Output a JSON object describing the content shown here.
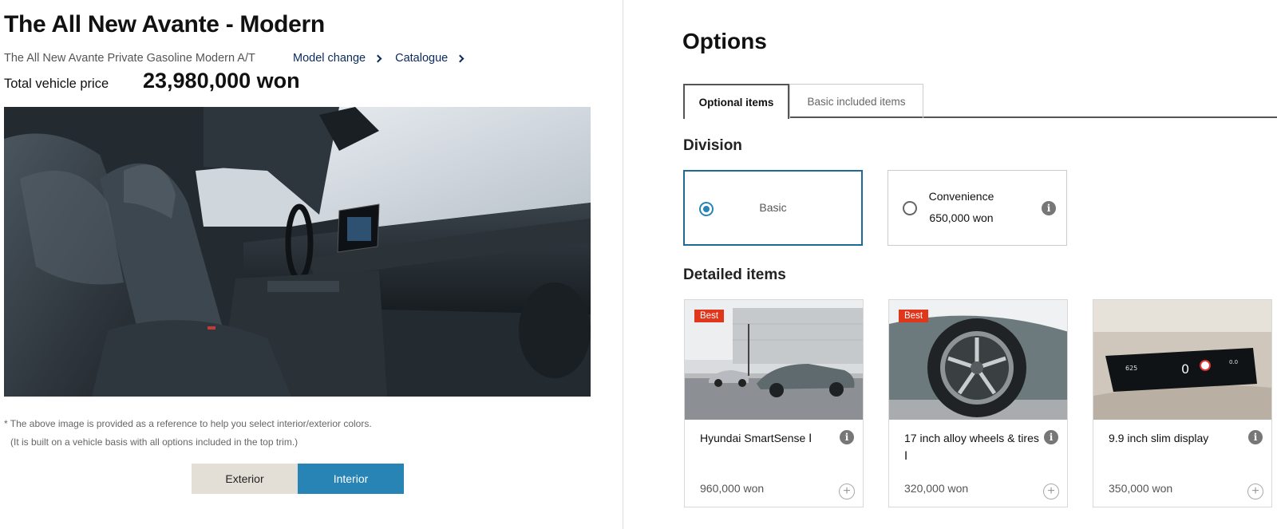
{
  "header": {
    "title": "The All New Avante - Modern",
    "model_name": "The All New Avante Private Gasoline Modern A/T",
    "model_change_label": "Model change",
    "catalogue_label": "Catalogue",
    "price_label": "Total vehicle price",
    "price_value": "23,980,000 won"
  },
  "preview": {
    "note_line1": "* The above image is provided as a reference to help you select interior/exterior colors.",
    "note_line2": "(It is built on a vehicle basis with all options included in the top trim.)",
    "view_buttons": [
      {
        "label": "Exterior",
        "selected": false
      },
      {
        "label": "Interior",
        "selected": true
      }
    ]
  },
  "options": {
    "title": "Options",
    "tabs": [
      {
        "label": "Optional items",
        "active": true
      },
      {
        "label": "Basic included items",
        "active": false
      }
    ],
    "division_title": "Division",
    "divisions": [
      {
        "name": "Basic",
        "price": "",
        "selected": true
      },
      {
        "name": "Convenience",
        "price": "650,000 won",
        "selected": false
      }
    ],
    "detailed_title": "Detailed items",
    "items": [
      {
        "name": "Hyundai SmartSense Ⅰ",
        "price": "960,000 won",
        "badge": "Best",
        "image": "car-on-road"
      },
      {
        "name": "17 inch alloy wheels & tires Ⅰ",
        "price": "320,000 won",
        "badge": "Best",
        "image": "alloy-wheel"
      },
      {
        "name": "9.9 inch slim display",
        "price": "350,000 won",
        "badge": "",
        "image": "slim-display"
      }
    ]
  },
  "colors": {
    "accent": "#2784b5",
    "selected_border": "#1e6a97",
    "badge": "#e0361b",
    "exterior_button": "#e4dfd6",
    "link": "#0a2a5c"
  }
}
